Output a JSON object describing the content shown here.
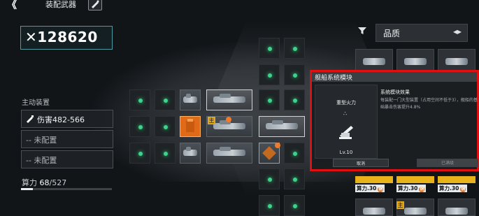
{
  "header": {
    "back_label": "《",
    "title": "装配武器"
  },
  "power": {
    "value": "✕128620"
  },
  "filter": {
    "quality_label": "品质",
    "sort_arrow": "◂▸"
  },
  "main_equipment": {
    "title": "主动装置",
    "slots": [
      {
        "label": "伤害482-566"
      },
      {
        "label": "-- 未配置"
      },
      {
        "label": "-- 未配置"
      }
    ]
  },
  "compute": {
    "label": "算力",
    "used": "68",
    "total": "/527"
  },
  "popup": {
    "title": "舰船系统模块",
    "module_name": "重型火力",
    "module_symbol": "∴",
    "level": "Lv.10",
    "effect_title": "系统模块效果",
    "effect_desc": "每装配一门大型装置（占用空间不低于3），舰船的基础暴击伤害提升4.8%",
    "cancel_label": "取消",
    "equipped_label": "已满级"
  },
  "slot_badge": "主",
  "inventory": {
    "tags": [
      "算力.30",
      "算力.30",
      "算力.30"
    ],
    "tag_icon": "铜"
  },
  "colors": {
    "accent": "#4e9aa2",
    "highlight": "#e01010",
    "node": "#3bd48a"
  }
}
